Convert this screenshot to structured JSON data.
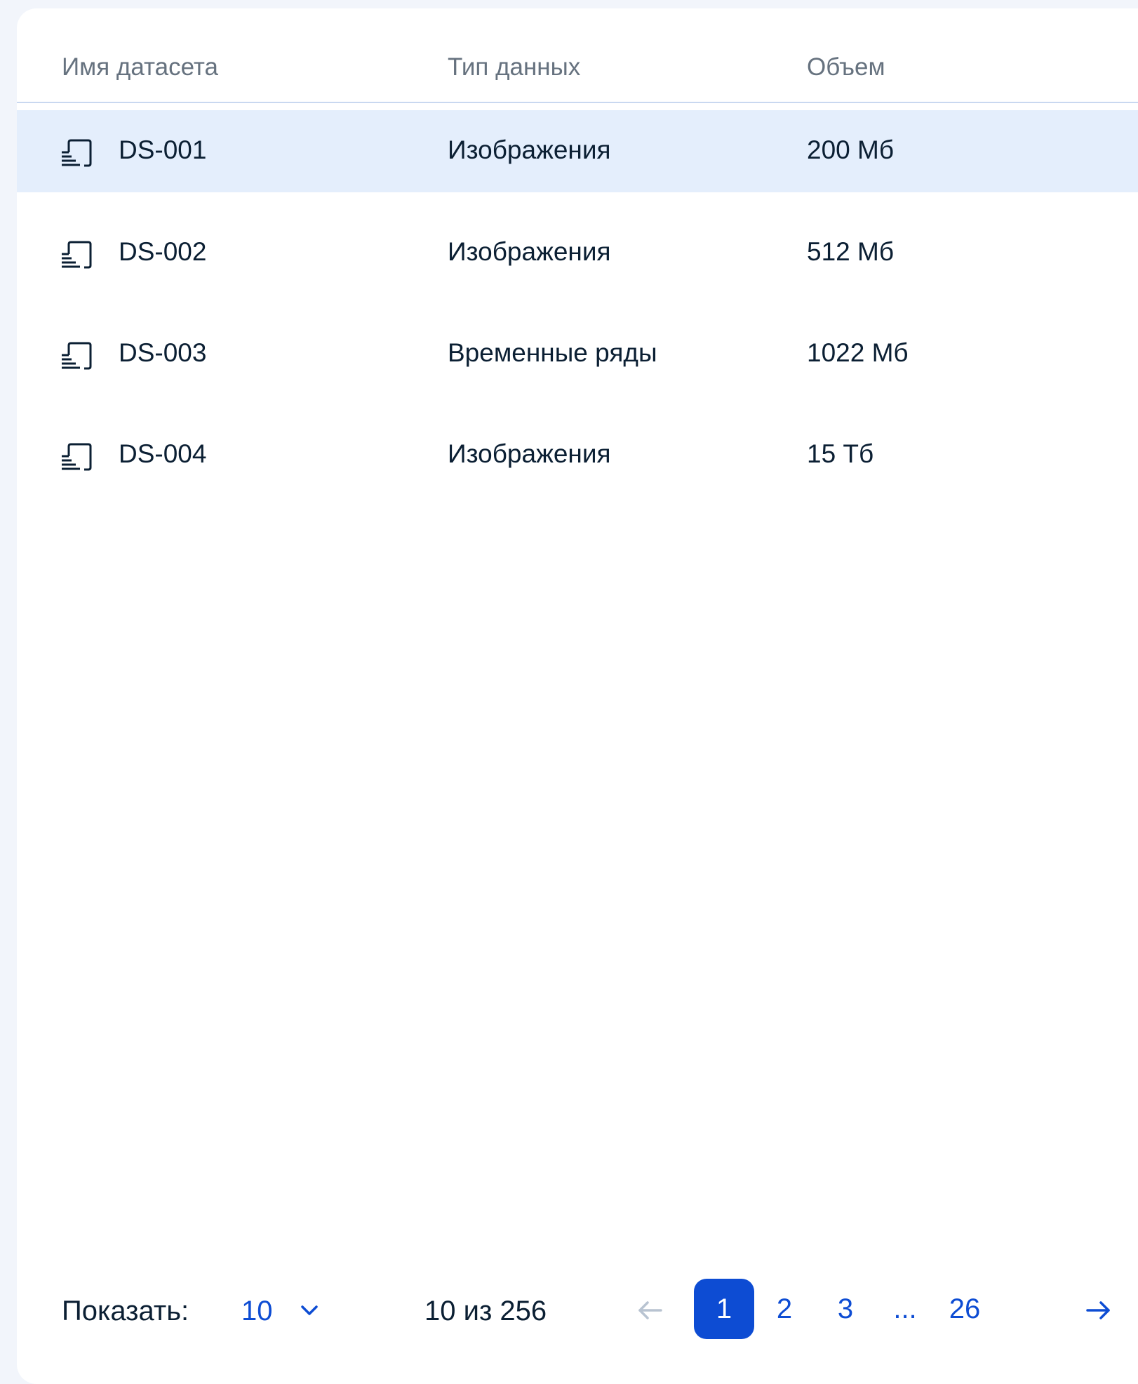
{
  "table": {
    "columns": [
      "Имя датасета",
      "Тип данных",
      "Объем"
    ],
    "rows": [
      {
        "name": "DS-001",
        "type": "Изображения",
        "size": "200 Мб",
        "selected": true
      },
      {
        "name": "DS-002",
        "type": "Изображения",
        "size": "512 Мб",
        "selected": false
      },
      {
        "name": "DS-003",
        "type": "Временные ряды",
        "size": "1022 Мб",
        "selected": false
      },
      {
        "name": "DS-004",
        "type": "Изображения",
        "size": "15 Тб",
        "selected": false
      }
    ],
    "row_icon": "dataset-icon"
  },
  "pagination": {
    "show_label": "Показать:",
    "page_size": "10",
    "range_text": "10 из 256",
    "pages": [
      "1",
      "2",
      "3",
      "...",
      "26"
    ],
    "current_page": "1",
    "prev_icon": "arrow-left-icon",
    "next_icon": "arrow-right-icon",
    "dropdown_icon": "chevron-down-icon"
  },
  "colors": {
    "accent": "#0d4cd3",
    "selected_row": "#e4eefc",
    "text": "#0b1f33",
    "header_text": "#66727f",
    "divider": "#c9d8f0",
    "disabled": "#b8c3d1"
  }
}
